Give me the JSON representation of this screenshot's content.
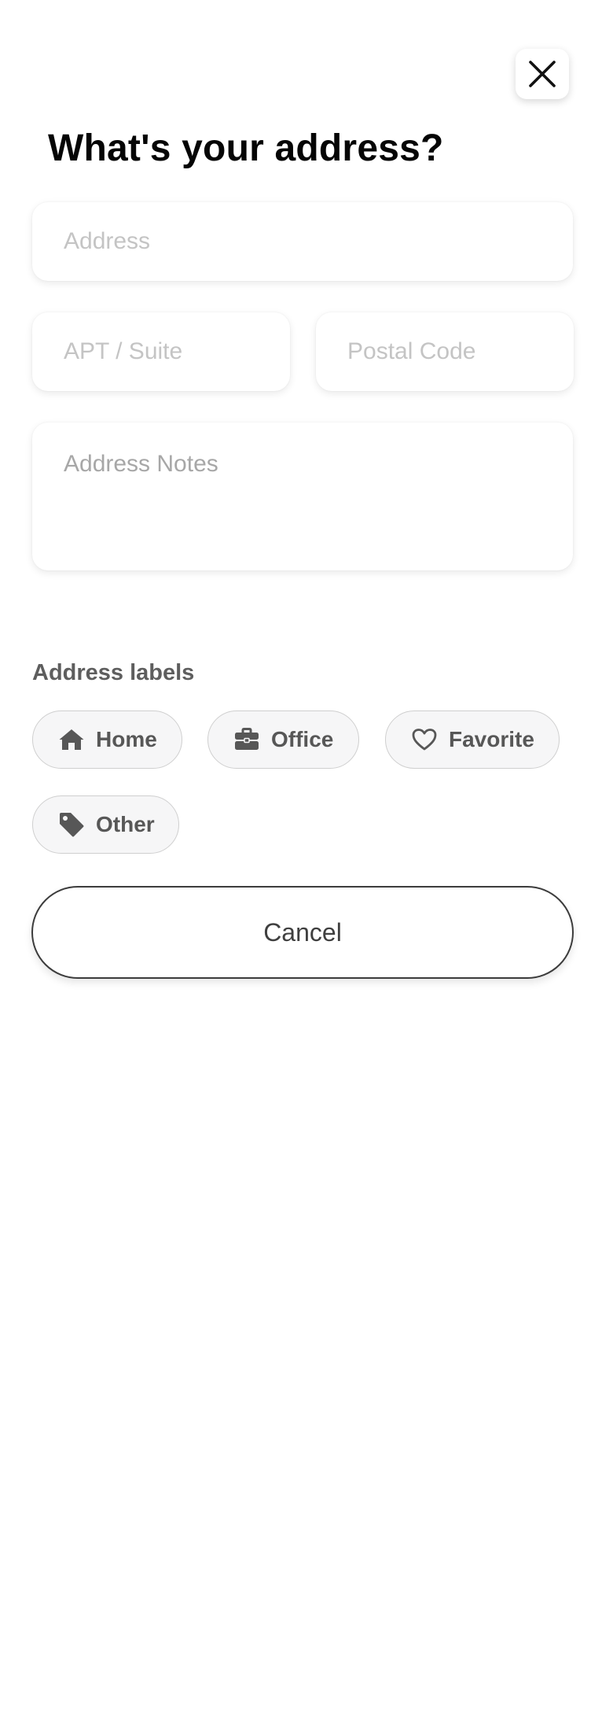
{
  "header": {
    "title": "What's your address?",
    "close_icon": "close-icon"
  },
  "form": {
    "address": {
      "value": "",
      "placeholder": "Address"
    },
    "apt": {
      "value": "",
      "placeholder": "APT / Suite"
    },
    "postal_code": {
      "value": "",
      "placeholder": "Postal Code"
    },
    "notes": {
      "value": "",
      "placeholder": "Address Notes"
    }
  },
  "labels": {
    "heading": "Address labels",
    "options": [
      {
        "label": "Home",
        "icon": "home-icon"
      },
      {
        "label": "Office",
        "icon": "briefcase-icon"
      },
      {
        "label": "Favorite",
        "icon": "heart-icon"
      },
      {
        "label": "Other",
        "icon": "tag-icon"
      }
    ]
  },
  "actions": {
    "cancel_label": "Cancel"
  },
  "colors": {
    "chip_background": "#f6f6f7",
    "chip_border": "#cfcfcf",
    "label_text": "#575757",
    "placeholder_light": "#c4c4c4",
    "placeholder_dark": "#a7a7a7"
  }
}
